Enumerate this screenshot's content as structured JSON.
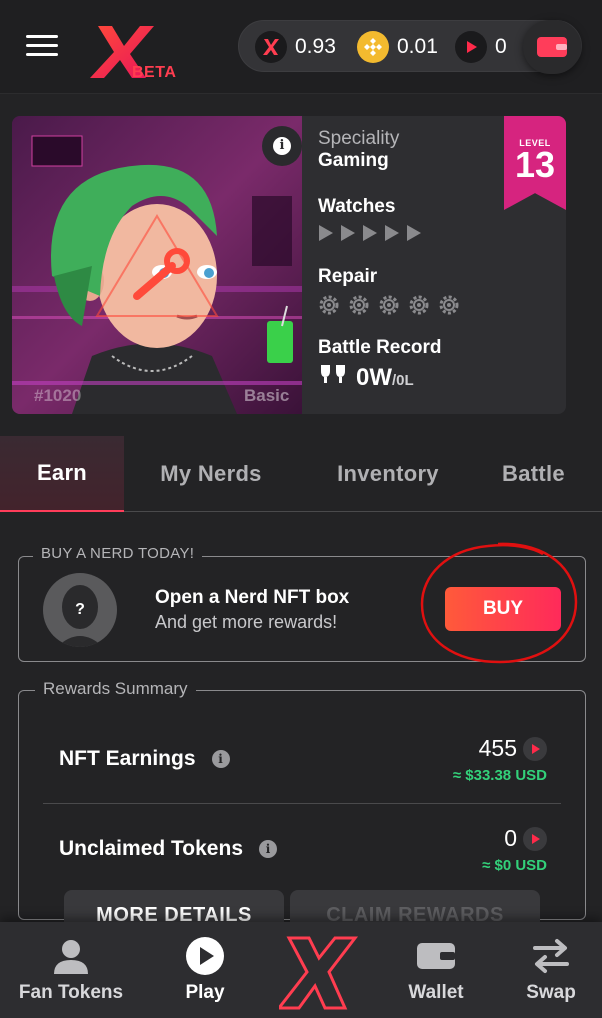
{
  "header": {
    "logo_badge": "BETA",
    "balances": [
      {
        "icon": "x-token-icon",
        "value": "0.93"
      },
      {
        "icon": "bnb-coin-icon",
        "value": "0.01"
      },
      {
        "icon": "play-token-icon",
        "value": "0"
      }
    ]
  },
  "nerd": {
    "id": "#1020",
    "rarity": "Basic",
    "speciality_label": "Speciality",
    "speciality_value": "Gaming",
    "watches_label": "Watches",
    "watches_count": 5,
    "repair_label": "Repair",
    "repair_count": 5,
    "battle_label": "Battle Record",
    "battle_wins": "0W",
    "battle_losses": "/0L",
    "level_label": "LEVEL",
    "level_value": "13"
  },
  "tabs": [
    {
      "label": "Earn",
      "active": true
    },
    {
      "label": "My Nerds",
      "active": false
    },
    {
      "label": "Inventory",
      "active": false
    },
    {
      "label": "Battle",
      "active": false
    }
  ],
  "buy": {
    "legend": "BUY A NERD TODAY!",
    "title": "Open a Nerd NFT box",
    "subtitle": "And get more rewards!",
    "button": "BUY"
  },
  "rewards": {
    "legend": "Rewards Summary",
    "rows": [
      {
        "label": "NFT Earnings",
        "value": "455",
        "usd": "≈ $33.38 USD"
      },
      {
        "label": "Unclaimed Tokens",
        "value": "0",
        "usd": "≈ $0 USD"
      }
    ],
    "more_details": "MORE DETAILS",
    "claim_rewards": "CLAIM REWARDS"
  },
  "bottom_nav": [
    {
      "label": "Fan Tokens",
      "icon": "user-icon"
    },
    {
      "label": "Play",
      "icon": "play-icon",
      "active": true
    },
    {
      "label": "",
      "icon": "x-logo-icon"
    },
    {
      "label": "Wallet",
      "icon": "wallet-icon"
    },
    {
      "label": "Swap",
      "icon": "swap-icon"
    }
  ],
  "colors": {
    "accent": "#ff3d50",
    "level_badge": "#d6247f",
    "usd_green": "#33d17a"
  }
}
